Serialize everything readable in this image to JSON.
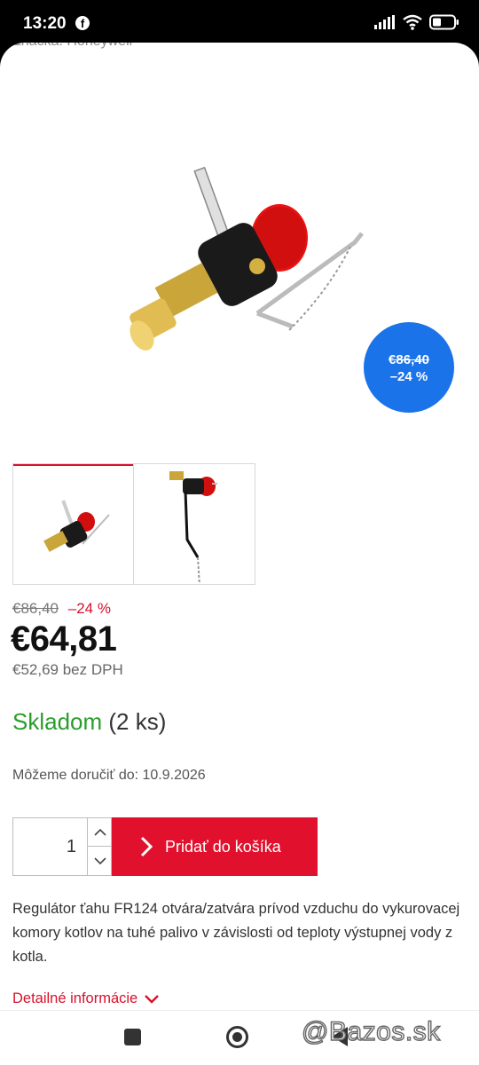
{
  "status_bar": {
    "time": "13:20",
    "facebook_icon": "f",
    "battery_icon": "battery-icon",
    "wifi_icon": "wifi-icon",
    "signal_icon": "signal-icon"
  },
  "product": {
    "brand_peek": "Značka: Honeywell",
    "image_icon": "regulator-image",
    "discount_badge": {
      "old_price": "€86,40",
      "percent": "–24 %"
    },
    "thumbnails": [
      "thumbnail-regulator",
      "thumbnail-regulator-chain"
    ],
    "price": {
      "old": "€86,40",
      "discount": "–24 %",
      "current": "€64,81",
      "net": "€52,69 bez DPH"
    },
    "stock": {
      "label": "Skladom",
      "count": "(2 ks)"
    },
    "delivery": "Môžeme doručiť do: 10.9.2026",
    "quantity": "1",
    "add_to_cart": "Pridať do košíka",
    "description": "Regulátor ťahu FR124 otvára/zatvára prívod vzduchu do vykurovacej komory kotlov na tuhé palivo v závislosti od teploty výstupnej vody z kotla.",
    "details_link": "Detailné informácie"
  },
  "colors": {
    "accent_red": "#e1112d",
    "stock_green": "#2a9d2a",
    "badge_blue": "#1a73e8"
  },
  "watermark": "@Bazos.sk"
}
